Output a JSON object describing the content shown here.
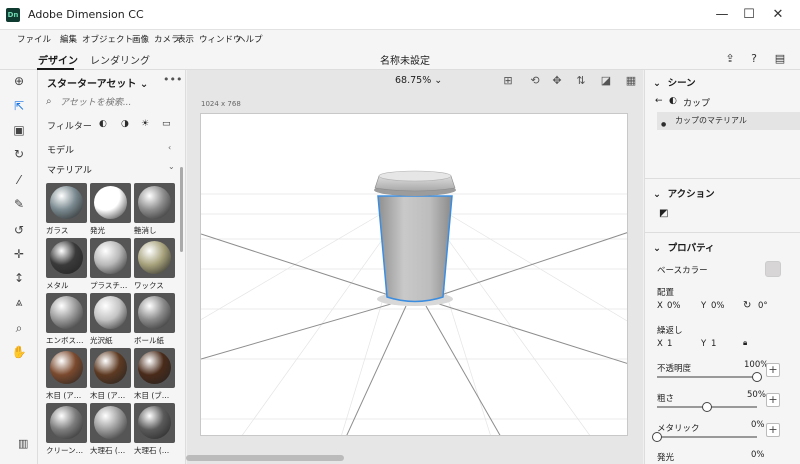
{
  "window": {
    "title": "Adobe Dimension CC",
    "app_badge": "Dn",
    "minimize": "—",
    "maximize": "☐",
    "close": "✕"
  },
  "menu": [
    "ファイル",
    "編集",
    "オブジェクト",
    "画像",
    "カメラ",
    "表示",
    "ウィンドウ",
    "ヘルプ"
  ],
  "modes": {
    "design": "デザイン",
    "render": "レンダリング"
  },
  "document_title": "名称未設定",
  "assets": {
    "title": "スターターアセット",
    "more": "•••",
    "search_placeholder": "アセットを検索...",
    "filter_label": "フィルター",
    "section_models": "モデル",
    "section_materials": "マテリアル",
    "tiles": [
      {
        "label": "ガラス",
        "color": "#7a8a90"
      },
      {
        "label": "発光",
        "color": "#ffffff"
      },
      {
        "label": "艶消し",
        "color": "#8d8d8d"
      },
      {
        "label": "メタル",
        "color": "#3a3a3a"
      },
      {
        "label": "プラスチ…",
        "color": "#b9b9b9"
      },
      {
        "label": "ワックス",
        "color": "#a7a27c"
      },
      {
        "label": "エンボス…",
        "color": "#9a9a9a"
      },
      {
        "label": "光沢紙",
        "color": "#c4c4c4"
      },
      {
        "label": "ボール紙",
        "color": "#8b8b8b"
      },
      {
        "label": "木目 (ア…",
        "color": "#7b4a2e"
      },
      {
        "label": "木目 (ア…",
        "color": "#5e3a22"
      },
      {
        "label": "木目 (ブ…",
        "color": "#4a2b1a"
      },
      {
        "label": "クリーン…",
        "color": "#7d7d7d"
      },
      {
        "label": "大理石 (…",
        "color": "#9c9c9c"
      },
      {
        "label": "大理石 (…",
        "color": "#5a5a5a"
      }
    ]
  },
  "canvas": {
    "zoom": "68.75%",
    "size_label": "1024 x 768"
  },
  "panel": {
    "scene_title": "シーン",
    "breadcrumb": "カップ",
    "layer_item": "カップのマテリアル",
    "actions_title": "アクション",
    "properties_title": "プロパティ",
    "base_color_label": "ベースカラー",
    "base_color": "#d7d5d5",
    "placement_label": "配置",
    "x_label": "X",
    "x_value": "0%",
    "y_label": "Y",
    "y_value": "0%",
    "rotate_value": "0°",
    "repeat_label": "繰返し",
    "repeat_x_label": "X",
    "repeat_x": "1",
    "repeat_y_label": "Y",
    "repeat_y": "1",
    "opacity_label": "不透明度",
    "opacity_value": "100%",
    "opacity_fraction": 1.0,
    "roughness_label": "粗さ",
    "roughness_value": "50%",
    "roughness_fraction": 0.5,
    "metallic_label": "メタリック",
    "metallic_value": "0%",
    "metallic_fraction": 0.0,
    "glow_label": "発光",
    "glow_value": "0%",
    "plus": "+"
  },
  "accent": "#1473e6"
}
